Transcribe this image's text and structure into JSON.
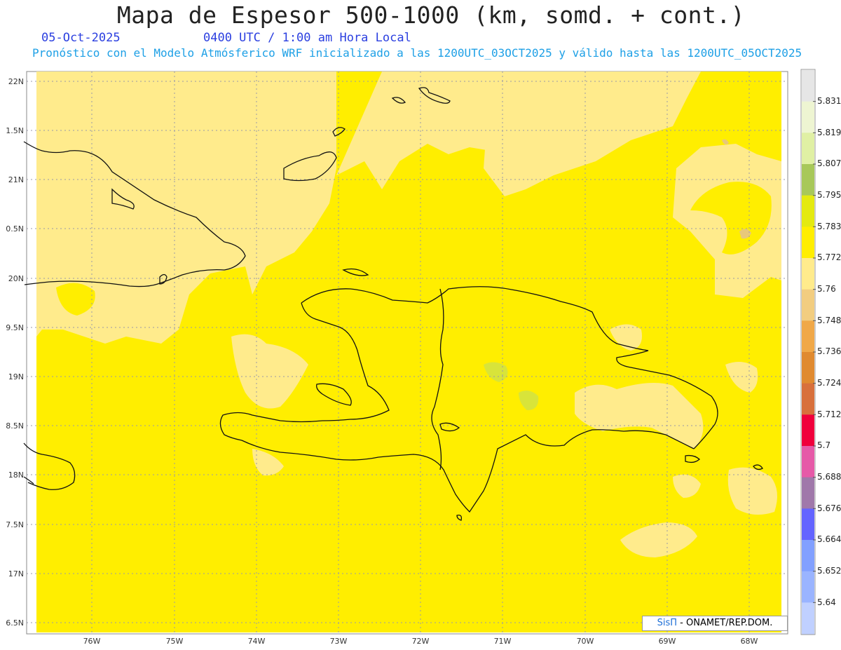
{
  "header": {
    "title": "Mapa de Espesor 500-1000 (km, somd. + cont.)",
    "date": "05-Oct-2025",
    "time": "0400 UTC / 1:00 am Hora Local",
    "model_info": "Pronóstico con el Modelo Atmósferico WRF inicializado a las 1200UTC_03OCT2025 y válido hasta las  1200UTC_05OCT2025"
  },
  "axes": {
    "lat_labels": [
      "22N",
      "1.5N",
      "21N",
      "0.5N",
      "20N",
      "9.5N",
      "19N",
      "8.5N",
      "18N",
      "7.5N",
      "17N",
      "6.5N"
    ],
    "lon_labels": [
      "76W",
      "75W",
      "74W",
      "73W",
      "72W",
      "71W",
      "70W",
      "69W",
      "68W"
    ]
  },
  "colorbar": {
    "labels": [
      "5.831",
      "5.819",
      "5.807",
      "5.795",
      "5.783",
      "5.772",
      "5.76",
      "5.748",
      "5.736",
      "5.724",
      "5.712",
      "5.7",
      "5.688",
      "5.676",
      "5.664",
      "5.652",
      "5.64"
    ],
    "colors": [
      "#e6e6e6",
      "#eef5d2",
      "#e0f0a4",
      "#a8c85a",
      "#e4ea10",
      "#ffee00",
      "#ffeb8c",
      "#f2cd80",
      "#f0a848",
      "#e08a30",
      "#d8703c",
      "#f0003c",
      "#e65aa8",
      "#a078aa",
      "#6464ff",
      "#82a0ff",
      "#9ab4ff",
      "#c0d0ff"
    ]
  },
  "credit": {
    "brand": "SisΠ",
    "text": " - ONAMET/REP.DOM."
  },
  "colors": {
    "field_main": "#ffee00",
    "field_light": "#ffeb8c",
    "field_green": "#d8e43a",
    "field_tan": "#e8c87a"
  }
}
